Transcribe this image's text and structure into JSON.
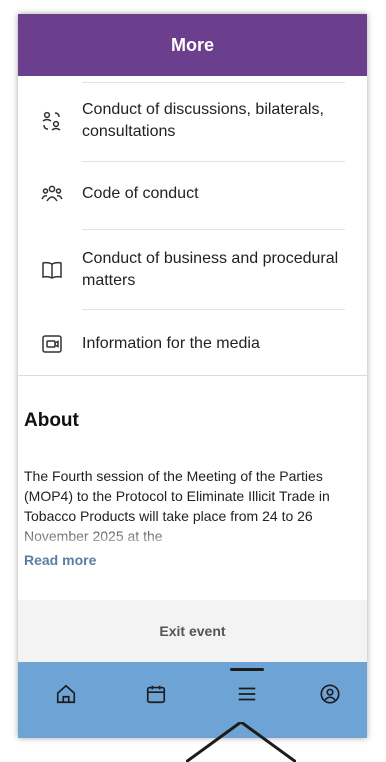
{
  "header": {
    "title": "More"
  },
  "menu": {
    "items": [
      {
        "label": "Conduct of discussions, bilaterals, consultations",
        "icon": "people-exchange-icon"
      },
      {
        "label": "Code of conduct",
        "icon": "group-icon"
      },
      {
        "label": "Conduct of business and procedural matters",
        "icon": "book-icon"
      },
      {
        "label": "Information for the media",
        "icon": "media-icon"
      }
    ]
  },
  "about": {
    "title": "About",
    "text": "The Fourth session of the Meeting of the Parties (MOP4) to the Protocol to Eliminate Illicit Trade in Tobacco Products will take place from 24 to 26 November 2025 at the",
    "read_more": "Read more"
  },
  "exit": {
    "label": "Exit event"
  },
  "tabbar": {
    "tabs": [
      {
        "icon": "home-icon"
      },
      {
        "icon": "calendar-icon"
      },
      {
        "icon": "menu-icon",
        "active": true
      },
      {
        "icon": "profile-icon"
      }
    ]
  },
  "colors": {
    "header": "#6b3f8d",
    "tabbar": "#6ea3d6",
    "read_more": "#5a7da3",
    "exit_band": "#f3f3f3"
  }
}
